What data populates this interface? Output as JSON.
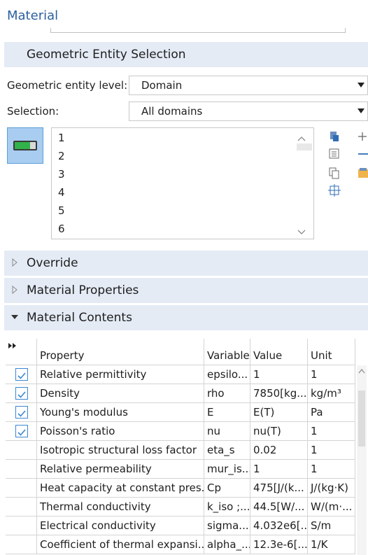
{
  "panel": {
    "title": "Material"
  },
  "geometric_entity_selection": {
    "header": "Geometric Entity Selection",
    "level_label": "Geometric entity level:",
    "level_value": "Domain",
    "selection_label": "Selection:",
    "selection_value": "All domains",
    "domains": [
      "1",
      "2",
      "3",
      "4",
      "5",
      "6"
    ]
  },
  "sections": {
    "override": "Override",
    "material_properties": "Material Properties",
    "material_contents": "Material Contents"
  },
  "table": {
    "columns": [
      "Property",
      "Variable",
      "Value",
      "Unit"
    ],
    "rows": [
      {
        "checked": true,
        "property": "Relative permittivity",
        "variable": "epsilo...",
        "value": "1",
        "unit": "1"
      },
      {
        "checked": true,
        "property": "Density",
        "variable": "rho",
        "value": "7850[kg...",
        "unit": "kg/m³"
      },
      {
        "checked": true,
        "property": "Young's modulus",
        "variable": "E",
        "value": "E(T)",
        "unit": "Pa"
      },
      {
        "checked": true,
        "property": "Poisson's ratio",
        "variable": "nu",
        "value": "nu(T)",
        "unit": "1"
      },
      {
        "checked": false,
        "property": "Isotropic structural loss factor",
        "variable": "eta_s",
        "value": "0.02",
        "unit": "1"
      },
      {
        "checked": false,
        "property": "Relative permeability",
        "variable": "mur_is...",
        "value": "1",
        "unit": "1"
      },
      {
        "checked": false,
        "property": "Heat capacity at constant pres...",
        "variable": "Cp",
        "value": "475[J/(k...",
        "unit": "J/(kg·K)"
      },
      {
        "checked": false,
        "property": "Thermal conductivity",
        "variable": "k_iso ;...",
        "value": "44.5[W/...",
        "unit": "W/(m·..."
      },
      {
        "checked": false,
        "property": "Electrical conductivity",
        "variable": "sigma...",
        "value": "4.032e6[...",
        "unit": "S/m"
      },
      {
        "checked": false,
        "property": "Coefficient of thermal expansi...",
        "variable": "alpha_...",
        "value": "12.3e-6[...",
        "unit": "1/K"
      }
    ]
  },
  "colors": {
    "accent": "#2c5f9e",
    "section_bg": "#e4ebf5",
    "checkbox": "#3b86d1",
    "toggle_bg": "#a8cdf0"
  }
}
